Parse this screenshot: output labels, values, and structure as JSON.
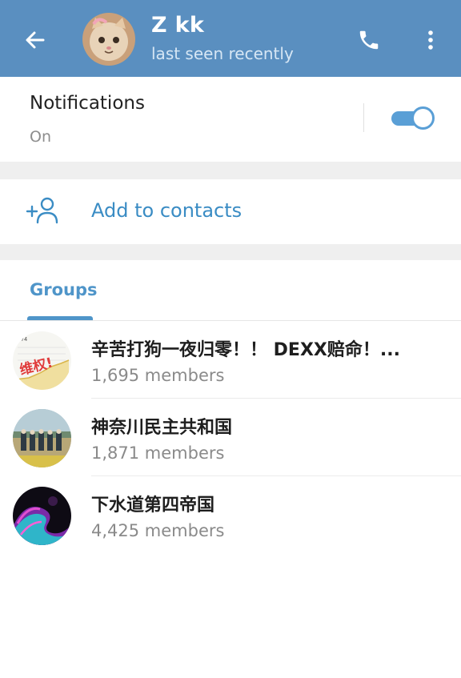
{
  "header": {
    "title": "Z kk",
    "status": "last seen recently",
    "icons": {
      "back": "back-arrow-icon",
      "call": "phone-icon",
      "menu": "more-vertical-icon"
    },
    "background_color": "#5a8fc0"
  },
  "notifications": {
    "label": "Notifications",
    "value": "On",
    "enabled": true,
    "accent_color": "#5a9fd6"
  },
  "add_contact": {
    "label": "Add to contacts",
    "icon": "add-person-icon",
    "color": "#3a8cc4"
  },
  "groups": {
    "tab_label": "Groups",
    "items": [
      {
        "name": "辛苦打狗一夜归零！！ DEXX赔命！...",
        "members": "1,695 members",
        "avatar_text": "维权!"
      },
      {
        "name": "神奈川民主共和国",
        "members": "1,871 members"
      },
      {
        "name": "下水道第四帝国",
        "members": "4,425 members"
      }
    ]
  }
}
